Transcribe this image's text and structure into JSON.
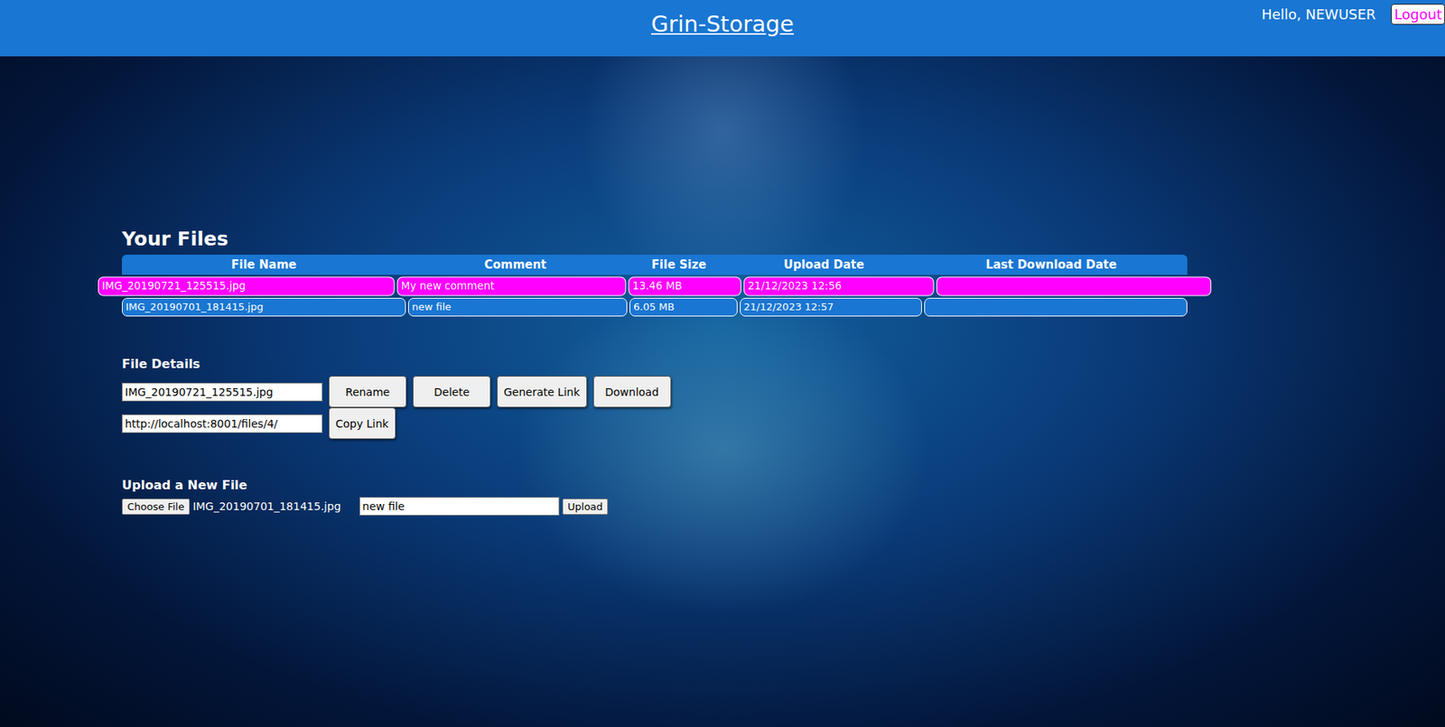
{
  "header": {
    "title": "Grin-Storage",
    "greeting": "Hello, NEWUSER",
    "logout": "Logout"
  },
  "files": {
    "title": "Your Files",
    "columns": [
      "File Name",
      "Comment",
      "File Size",
      "Upload Date",
      "Last Download Date"
    ],
    "rows": [
      {
        "cells": [
          "IMG_20190721_125515.jpg",
          "My new comment",
          "13.46 MB",
          "21/12/2023 12:56",
          ""
        ],
        "selected": true
      },
      {
        "cells": [
          "IMG_20190701_181415.jpg",
          "new file",
          "6.05 MB",
          "21/12/2023 12:57",
          ""
        ],
        "selected": false
      }
    ]
  },
  "details": {
    "title": "File Details",
    "name": "IMG_20190721_125515.jpg",
    "link": "http://localhost:8001/files/4/",
    "buttons": [
      "Rename",
      "Delete",
      "Generate Link",
      "Download"
    ],
    "copy": "Copy Link"
  },
  "upload": {
    "title": "Upload a New File",
    "choose": "Choose File",
    "chosen": "IMG_20190701_181415.jpg",
    "comment": "new file",
    "submit": "Upload"
  }
}
